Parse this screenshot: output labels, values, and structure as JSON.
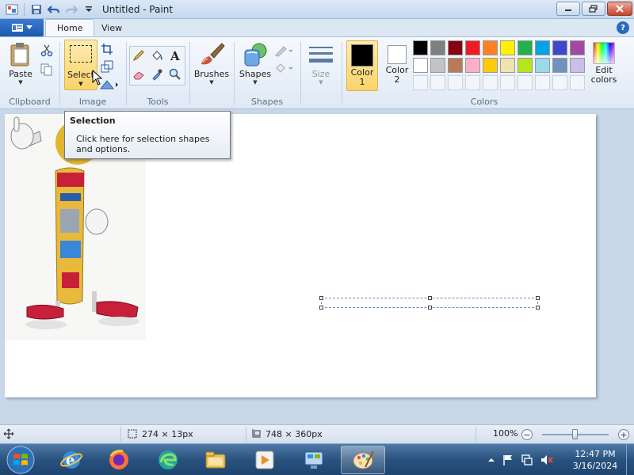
{
  "window": {
    "title": "Untitled - Paint"
  },
  "tabs": {
    "home": "Home",
    "view": "View"
  },
  "ribbon": {
    "clipboard": {
      "group": "Clipboard",
      "paste": "Paste"
    },
    "image": {
      "group": "Image",
      "select": "Select"
    },
    "tools": {
      "group": "Tools"
    },
    "brushes": {
      "label": "Brushes"
    },
    "shapes": {
      "group": "Shapes",
      "label": "Shapes"
    },
    "size": {
      "label": "Size"
    },
    "colors": {
      "group": "Colors",
      "color1_line1": "Color",
      "color1_line2": "1",
      "color2_line1": "Color",
      "color2_line2": "2",
      "color1_value": "#000000",
      "color2_value": "#ffffff",
      "edit_line1": "Edit",
      "edit_line2": "colors",
      "palette_row1": [
        "#000000",
        "#7f7f7f",
        "#880015",
        "#ed1c24",
        "#ff7f27",
        "#fff200",
        "#22b14c",
        "#00a2e8",
        "#3f48cc",
        "#a349a4"
      ],
      "palette_row2": [
        "#ffffff",
        "#c3c3c3",
        "#b97a57",
        "#ffaec9",
        "#ffc90e",
        "#efe4b0",
        "#b5e61d",
        "#99d9ea",
        "#7092be",
        "#c8bfe7"
      ]
    }
  },
  "tooltip": {
    "title": "Selection",
    "description": "Click here for selection shapes and options."
  },
  "status": {
    "selection_size": "274 × 13px",
    "image_size": "748 × 360px",
    "zoom": "100%",
    "zoom_fraction": 0.5
  },
  "taskbar": {
    "time": "12:47 PM",
    "date": "3/16/2024"
  }
}
